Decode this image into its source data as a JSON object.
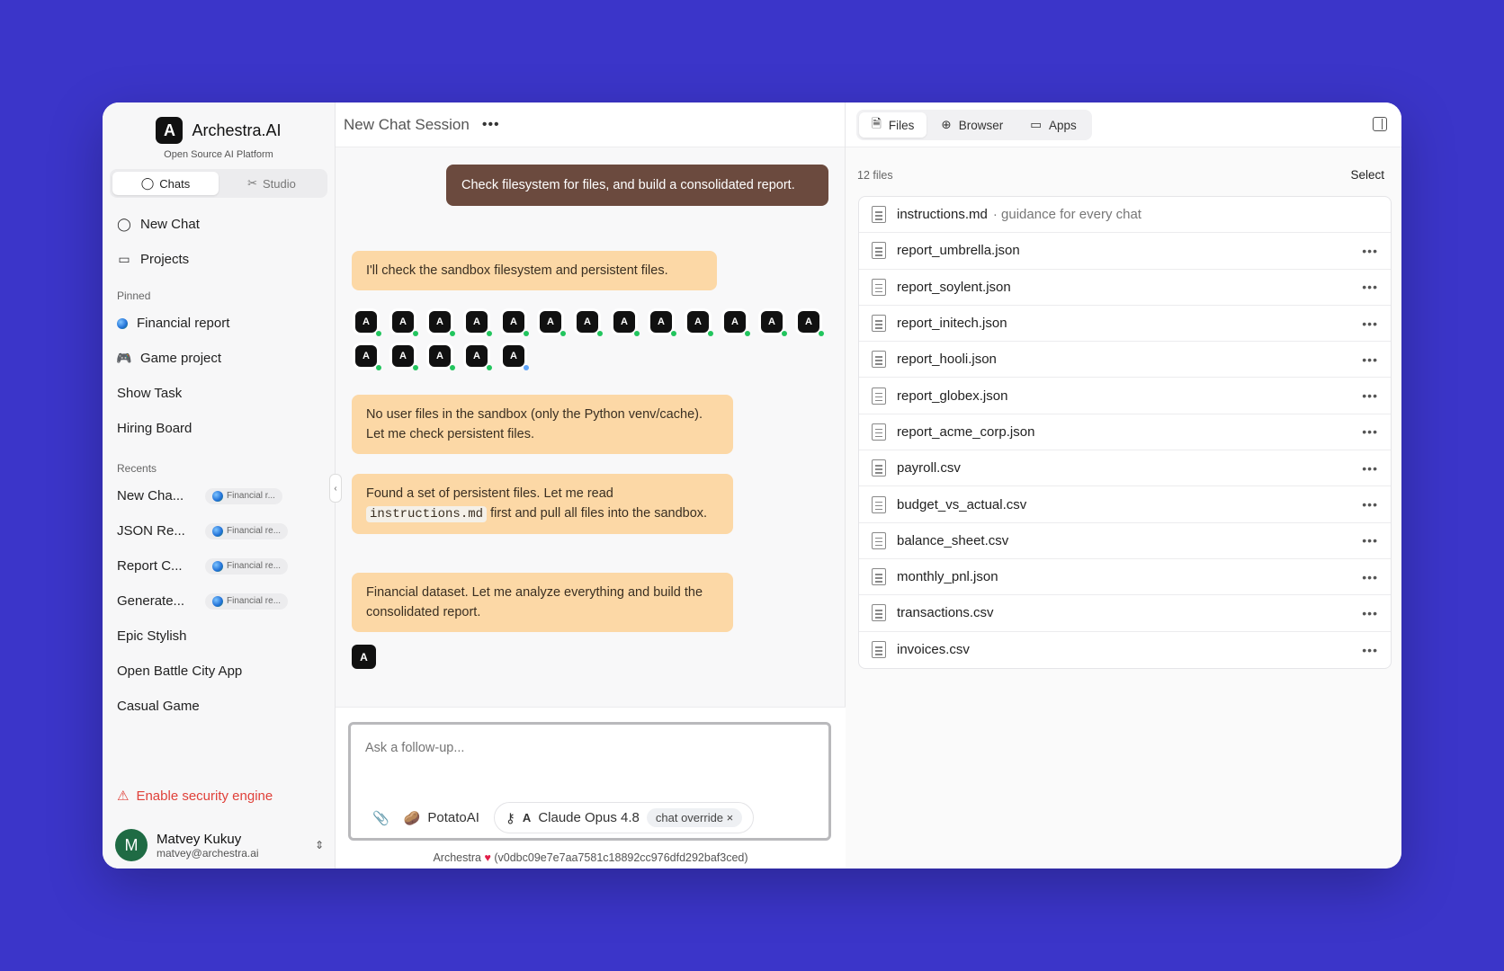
{
  "brand": {
    "name": "Archestra.AI",
    "subtitle": "Open Source AI Platform",
    "logo_glyph": "A"
  },
  "sidebar": {
    "segments": [
      {
        "label": "Chats"
      },
      {
        "label": "Studio"
      }
    ],
    "nav": [
      {
        "label": "New Chat"
      },
      {
        "label": "Projects"
      }
    ],
    "pinned_label": "Pinned",
    "pinned": [
      {
        "label": "Financial report"
      },
      {
        "label": "Game project"
      },
      {
        "label": "Show Task"
      },
      {
        "label": "Hiring Board"
      }
    ],
    "recents_label": "Recents",
    "recents": [
      {
        "label": "New Cha...",
        "chip": "Financial r..."
      },
      {
        "label": "JSON Re...",
        "chip": "Financial re..."
      },
      {
        "label": "Report C...",
        "chip": "Financial re..."
      },
      {
        "label": "Generate...",
        "chip": "Financial re..."
      },
      {
        "label": "Epic Stylish"
      },
      {
        "label": "Open Battle City App"
      },
      {
        "label": "Casual Game"
      }
    ],
    "security_label": "Enable security engine",
    "user": {
      "initial": "M",
      "name": "Matvey Kukuy",
      "email": "matvey@archestra.ai"
    }
  },
  "chat": {
    "title": "New Chat Session",
    "user_message": "Check filesystem for files, and build a consolidated report.",
    "messages": [
      "I'll check the sandbox filesystem and persistent files.",
      "No user files in the sandbox (only the Python venv/cache). Let me check persistent files.",
      {
        "before": "Found a set of persistent files. Let me read",
        "code": "instructions.md",
        "after": "first and pull all files into the sandbox."
      },
      "Financial dataset. Let me analyze everything and build the consolidated report."
    ],
    "tool_calls_count": 18,
    "composer": {
      "placeholder": "Ask a follow-up...",
      "agent": "PotatoAI",
      "model": "Claude Opus 4.8",
      "override": "chat override"
    },
    "footer": {
      "brand": "Archestra",
      "version": "(v0dbc09e7e7aa7581c18892cc976dfd292baf3ced)"
    }
  },
  "files_panel": {
    "tabs": [
      {
        "label": "Files"
      },
      {
        "label": "Browser"
      },
      {
        "label": "Apps"
      }
    ],
    "count": "12 files",
    "select_label": "Select",
    "files": [
      {
        "name": "instructions.md",
        "desc": "· guidance for every chat"
      },
      {
        "name": "report_umbrella.json"
      },
      {
        "name": "report_soylent.json"
      },
      {
        "name": "report_initech.json"
      },
      {
        "name": "report_hooli.json"
      },
      {
        "name": "report_globex.json"
      },
      {
        "name": "report_acme_corp.json"
      },
      {
        "name": "payroll.csv"
      },
      {
        "name": "budget_vs_actual.csv"
      },
      {
        "name": "balance_sheet.csv"
      },
      {
        "name": "monthly_pnl.json"
      },
      {
        "name": "transactions.csv"
      },
      {
        "name": "invoices.csv"
      }
    ]
  },
  "colors": {
    "background": "#3b35c9",
    "user_bubble": "#6b4a3e",
    "bot_bubble": "#fcd8a6",
    "danger": "#e0413a"
  }
}
